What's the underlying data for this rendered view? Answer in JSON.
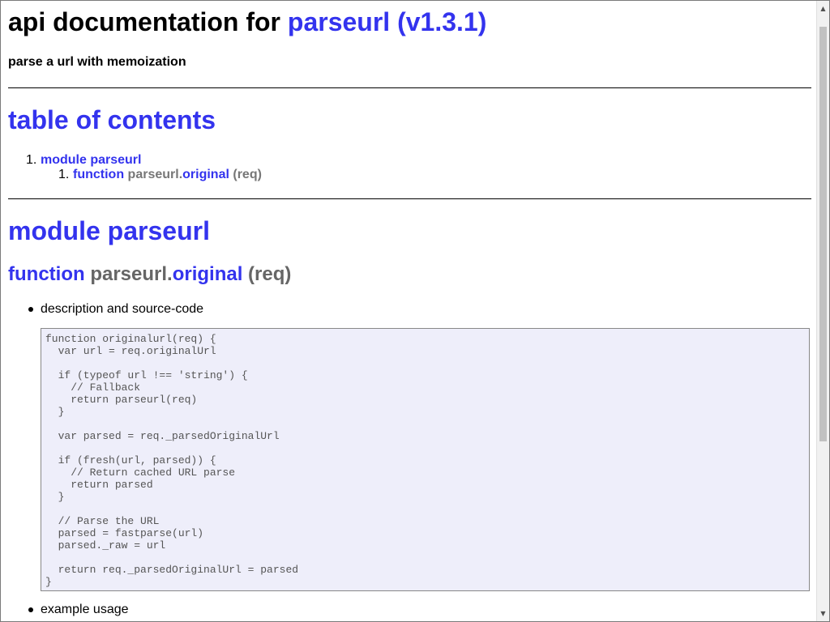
{
  "header": {
    "title_prefix": "api documentation for",
    "title_link": "parseurl (v1.3.1)",
    "subtitle": "parse a url with memoization"
  },
  "toc": {
    "heading": "table of contents",
    "items": [
      {
        "number": "1.",
        "label": "module parseurl"
      }
    ],
    "subitems": [
      {
        "number": "1.",
        "keyword": "function",
        "object": "parseurl.",
        "member": "original",
        "args": "(req)"
      }
    ]
  },
  "module": {
    "heading": "module parseurl",
    "function": {
      "keyword": "function",
      "object": "parseurl.",
      "member": "original",
      "args": "(req)"
    }
  },
  "details": {
    "description_label": "description and source-code",
    "example_label": "example usage",
    "source_code": "function originalurl(req) {\n  var url = req.originalUrl\n\n  if (typeof url !== 'string') {\n    // Fallback\n    return parseurl(req)\n  }\n\n  var parsed = req._parsedOriginalUrl\n\n  if (fresh(url, parsed)) {\n    // Return cached URL parse\n    return parsed\n  }\n\n  // Parse the URL\n  parsed = fastparse(url)\n  parsed._raw = url\n\n  return req._parsedOriginalUrl = parsed\n}"
  },
  "scrollbar": {
    "up_icon": "arrow-up-icon",
    "down_icon": "arrow-down-icon"
  }
}
